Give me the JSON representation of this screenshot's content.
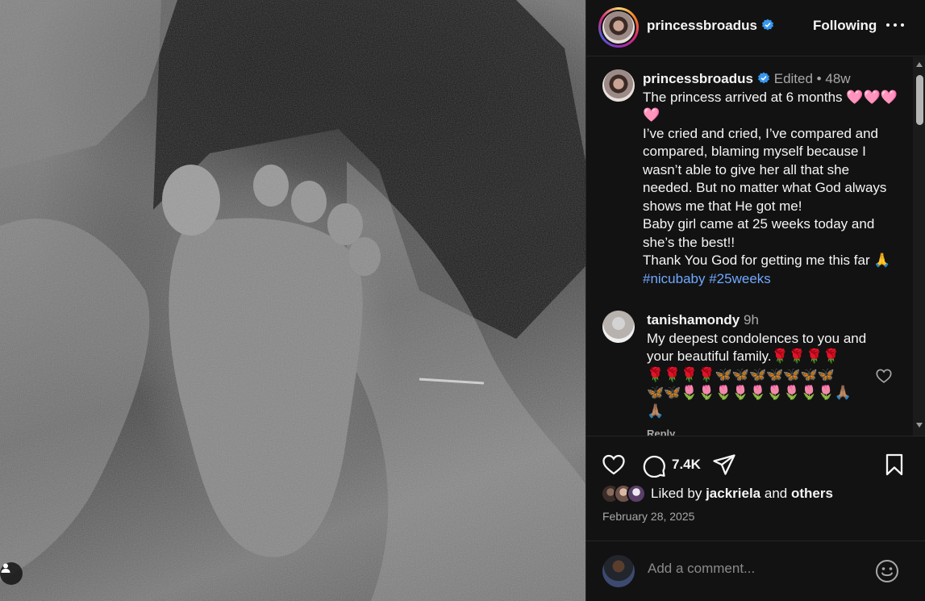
{
  "post": {
    "author": "princessbroadus",
    "follow_state": "Following"
  },
  "caption": {
    "username": "princessbroadus",
    "edited": "Edited",
    "separator": "•",
    "age": "48w",
    "body": "The princess arrived at 6 months 🩷🩷🩷🩷\nI’ve cried and cried, I’ve compared and compared, blaming myself because I wasn’t able to give her all that she needed. But no matter what God always shows me that He got me!\nBaby girl came at 25 weeks today and she’s the best!!\nThank You God for getting me this far 🙏",
    "hashtags": "#nicubaby #25weeks"
  },
  "comment": {
    "username": "tanishamondy",
    "age": "9h",
    "text": "My deepest condolences to you and your beautiful family.🌹🌹🌹🌹\n🌹🌹🌹🌹🦋🦋🦋🦋🦋🦋🦋\n🦋🦋🌷🌷🌷🌷🌷🌷🌷🌷🌷🙏🏽\n🙏🏽",
    "reply_label": "Reply"
  },
  "actions": {
    "comment_count": "7.4K"
  },
  "likes": {
    "prefix": "Liked by",
    "user": "jackriela",
    "conjunction": "and",
    "suffix": "others"
  },
  "date": "February 28, 2025",
  "compose": {
    "placeholder": "Add a comment..."
  },
  "colors": {
    "panel_bg": "#121212",
    "hashtag": "#6fa8ff",
    "verified": "#3897f0",
    "muted": "#a8a8a8"
  }
}
